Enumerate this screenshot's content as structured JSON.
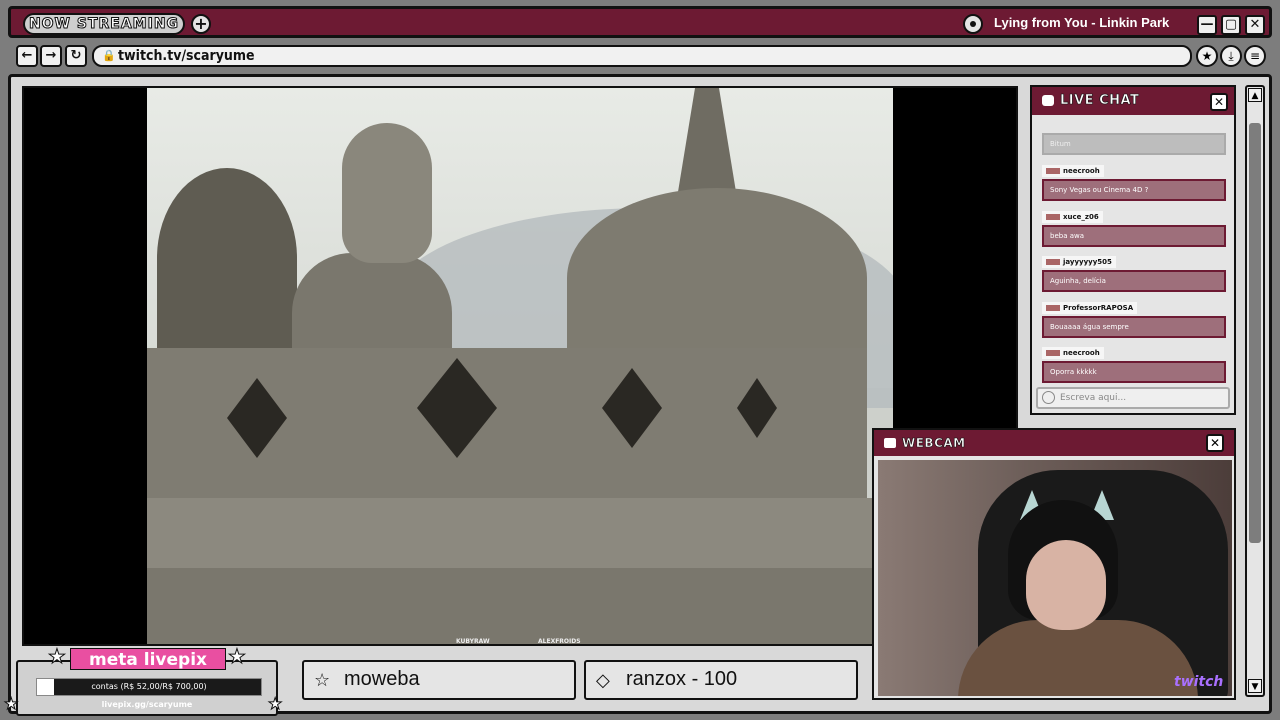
{
  "titlebar": {
    "badge": "NOW STREAMING",
    "add_label": "+",
    "song": "Lying from You - Linkin Park",
    "minimize": "—",
    "maximize": "▢",
    "close": "✕"
  },
  "address": {
    "back": "←",
    "forward": "→",
    "reload": "↻",
    "url": "twitch.tv/scaryume",
    "bookmark": "★",
    "download": "⤓",
    "menu": "≡"
  },
  "video": {
    "credits": [
      "KUBYRAW",
      "ALEXFROIDS"
    ]
  },
  "chat": {
    "title": "LIVE CHAT",
    "close": "✕",
    "faded_message": "Bitum",
    "messages": [
      {
        "user": "neecrooh",
        "text": "Sony Vegas ou Cinema 4D ?"
      },
      {
        "user": "xuce_z06",
        "text": "beba awa"
      },
      {
        "user": "jayyyyyy505",
        "text": "Aguinha, delícia"
      },
      {
        "user": "ProfessorRAPOSA",
        "text": "Bouaaaa água sempre"
      },
      {
        "user": "neecrooh",
        "text": "Oporra kkkkk"
      }
    ],
    "input_placeholder": "Escreva aqui..."
  },
  "webcam": {
    "title": "WEBCAM",
    "close": "✕",
    "logo": "twitch"
  },
  "livepix": {
    "title": "meta livepix",
    "progress_text": "contas (R$ 52,00/R$ 700,00)",
    "progress_fraction": 0.074,
    "url": "livepix.gg/scaryume"
  },
  "goals": [
    {
      "icon": "☆",
      "text": "moweba"
    },
    {
      "icon": "◇",
      "text": "ranzox - 100"
    }
  ],
  "colors": {
    "accent": "#6d1a33",
    "pink": "#e94fa1",
    "chat_box": "#9e6f7b",
    "twitch": "#a970ff"
  }
}
